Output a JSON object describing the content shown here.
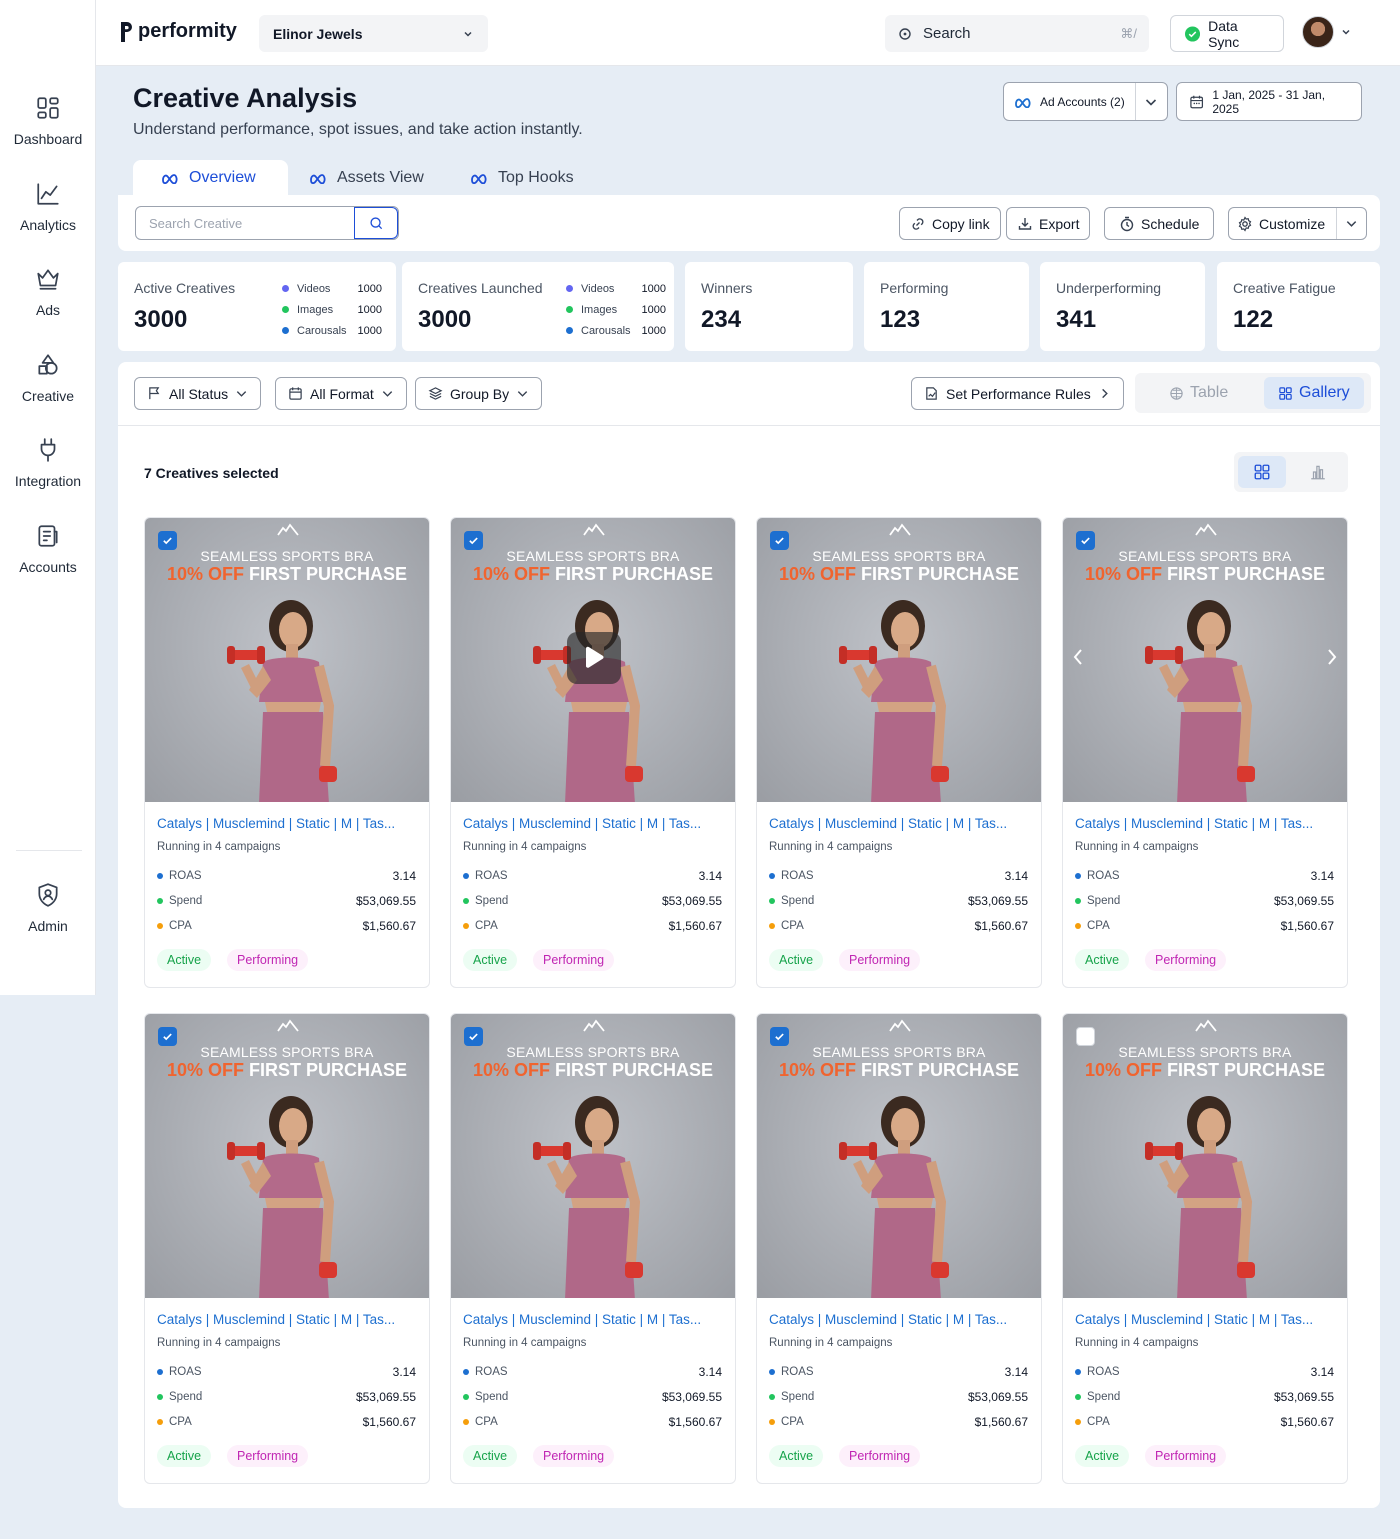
{
  "app": {
    "logo_text": "performity",
    "brand_select": "Elinor Jewels",
    "search_placeholder": "Search",
    "search_shortcut": "⌘/",
    "data_sync_label": "Data Sync"
  },
  "sidebar": {
    "items": [
      {
        "label": "Dashboard",
        "icon": "dashboard-icon"
      },
      {
        "label": "Analytics",
        "icon": "analytics-icon"
      },
      {
        "label": "Ads",
        "icon": "crown-icon"
      },
      {
        "label": "Creative",
        "icon": "creative-icon"
      },
      {
        "label": "Integration",
        "icon": "plug-icon"
      },
      {
        "label": "Accounts",
        "icon": "accounts-icon"
      },
      {
        "label": "Admin",
        "icon": "admin-icon"
      }
    ]
  },
  "header": {
    "title": "Creative Analysis",
    "subtitle": "Understand performance, spot issues, and take action instantly.",
    "ad_accounts": "Ad Accounts (2)",
    "date_range": "1 Jan, 2025 - 31 Jan, 2025"
  },
  "tabs": [
    {
      "label": "Overview",
      "active": true
    },
    {
      "label": "Assets View",
      "active": false
    },
    {
      "label": "Top Hooks",
      "active": false
    }
  ],
  "toolbar": {
    "search_placeholder": "Search Creative",
    "copy_link": "Copy link",
    "export": "Export",
    "schedule": "Schedule",
    "customize": "Customize"
  },
  "kpis": {
    "active": {
      "label": "Active Creatives",
      "value": "3000",
      "breakdown": [
        {
          "name": "Videos",
          "count": "1000"
        },
        {
          "name": "Images",
          "count": "1000"
        },
        {
          "name": "Carousals",
          "count": "1000"
        }
      ]
    },
    "launched": {
      "label": "Creatives Launched",
      "value": "3000",
      "breakdown": [
        {
          "name": "Videos",
          "count": "1000"
        },
        {
          "name": "Images",
          "count": "1000"
        },
        {
          "name": "Carousals",
          "count": "1000"
        }
      ]
    },
    "winners": {
      "label": "Winners",
      "value": "234"
    },
    "performing": {
      "label": "Performing",
      "value": "123"
    },
    "underperforming": {
      "label": "Underperforming",
      "value": "341"
    },
    "fatigue": {
      "label": "Creative Fatigue",
      "value": "122"
    }
  },
  "filters": {
    "status": "All Status",
    "format": "All Format",
    "group_by": "Group By",
    "perf_rules": "Set Performance Rules",
    "view_table": "Table",
    "view_gallery": "Gallery"
  },
  "gallery": {
    "selected_text": "7 Creatives selected",
    "cards": [
      {
        "checked": true,
        "media": "image",
        "promo_line1": "SEAMLESS SPORTS BRA",
        "promo_hl": "10% OFF",
        "promo_rest": "FIRST PURCHASE",
        "title": "Catalys | Musclemind | Static | M | Tas...",
        "campaigns": "Running in 4 campaigns",
        "roas_label": "ROAS",
        "roas": "3.14",
        "spend_label": "Spend",
        "spend": "$53,069.55",
        "cpa_label": "CPA",
        "cpa": "$1,560.67",
        "status": "Active",
        "performance": "Performing"
      },
      {
        "checked": true,
        "media": "video",
        "promo_line1": "SEAMLESS SPORTS BRA",
        "promo_hl": "10% OFF",
        "promo_rest": "FIRST PURCHASE",
        "title": "Catalys | Musclemind | Static | M | Tas...",
        "campaigns": "Running in 4 campaigns",
        "roas_label": "ROAS",
        "roas": "3.14",
        "spend_label": "Spend",
        "spend": "$53,069.55",
        "cpa_label": "CPA",
        "cpa": "$1,560.67",
        "status": "Active",
        "performance": "Performing"
      },
      {
        "checked": true,
        "media": "image",
        "promo_line1": "SEAMLESS SPORTS BRA",
        "promo_hl": "10% OFF",
        "promo_rest": "FIRST PURCHASE",
        "title": "Catalys | Musclemind | Static | M | Tas...",
        "campaigns": "Running in 4 campaigns",
        "roas_label": "ROAS",
        "roas": "3.14",
        "spend_label": "Spend",
        "spend": "$53,069.55",
        "cpa_label": "CPA",
        "cpa": "$1,560.67",
        "status": "Active",
        "performance": "Performing"
      },
      {
        "checked": true,
        "media": "carousel",
        "promo_line1": "SEAMLESS SPORTS BRA",
        "promo_hl": "10% OFF",
        "promo_rest": "FIRST PURCHASE",
        "title": "Catalys | Musclemind | Static | M | Tas...",
        "campaigns": "Running in 4 campaigns",
        "roas_label": "ROAS",
        "roas": "3.14",
        "spend_label": "Spend",
        "spend": "$53,069.55",
        "cpa_label": "CPA",
        "cpa": "$1,560.67",
        "status": "Active",
        "performance": "Performing"
      },
      {
        "checked": true,
        "media": "image",
        "promo_line1": "SEAMLESS SPORTS BRA",
        "promo_hl": "10% OFF",
        "promo_rest": "FIRST PURCHASE",
        "title": "Catalys | Musclemind | Static | M | Tas...",
        "campaigns": "Running in 4 campaigns",
        "roas_label": "ROAS",
        "roas": "3.14",
        "spend_label": "Spend",
        "spend": "$53,069.55",
        "cpa_label": "CPA",
        "cpa": "$1,560.67",
        "status": "Active",
        "performance": "Performing"
      },
      {
        "checked": true,
        "media": "image",
        "promo_line1": "SEAMLESS SPORTS BRA",
        "promo_hl": "10% OFF",
        "promo_rest": "FIRST PURCHASE",
        "title": "Catalys | Musclemind | Static | M | Tas...",
        "campaigns": "Running in 4 campaigns",
        "roas_label": "ROAS",
        "roas": "3.14",
        "spend_label": "Spend",
        "spend": "$53,069.55",
        "cpa_label": "CPA",
        "cpa": "$1,560.67",
        "status": "Active",
        "performance": "Performing"
      },
      {
        "checked": true,
        "media": "image",
        "promo_line1": "SEAMLESS SPORTS BRA",
        "promo_hl": "10% OFF",
        "promo_rest": "FIRST PURCHASE",
        "title": "Catalys | Musclemind | Static | M | Tas...",
        "campaigns": "Running in 4 campaigns",
        "roas_label": "ROAS",
        "roas": "3.14",
        "spend_label": "Spend",
        "spend": "$53,069.55",
        "cpa_label": "CPA",
        "cpa": "$1,560.67",
        "status": "Active",
        "performance": "Performing"
      },
      {
        "checked": false,
        "media": "image",
        "promo_line1": "SEAMLESS SPORTS BRA",
        "promo_hl": "10% OFF",
        "promo_rest": "FIRST PURCHASE",
        "title": "Catalys | Musclemind | Static | M | Tas...",
        "campaigns": "Running in 4 campaigns",
        "roas_label": "ROAS",
        "roas": "3.14",
        "spend_label": "Spend",
        "spend": "$53,069.55",
        "cpa_label": "CPA",
        "cpa": "$1,560.67",
        "status": "Active",
        "performance": "Performing"
      }
    ]
  },
  "colors": {
    "accent": "#1d6fd0",
    "videos_dot": "#6366f1",
    "images_dot": "#22c55e",
    "carousals_dot": "#1d6fd0",
    "roas_dot": "#1d6fd0",
    "spend_dot": "#22c55e",
    "cpa_dot": "#f59e0b",
    "promo_highlight": "#f0642f"
  }
}
